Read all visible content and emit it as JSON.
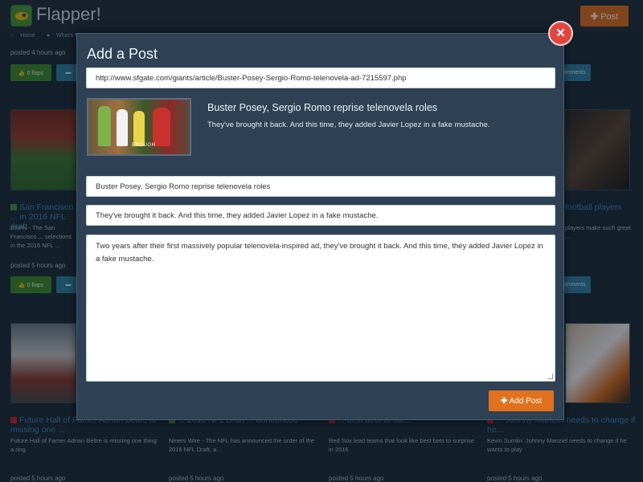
{
  "app": {
    "brand": "Flapper!"
  },
  "header": {
    "post_button_label": "Post",
    "post_button_icon": "plus-icon"
  },
  "breadcrumb": {
    "home": "Home",
    "whats_new": "What's New"
  },
  "background": {
    "top_posted": "posted 4 hours ago",
    "flap_label": "0 flaps",
    "comments_label": "comments",
    "row1": {
      "posted": "posted 5 hours ago",
      "cards": [
        {
          "title": "San Francisco ... in 2016 NFL draft",
          "desc": "ESPN - The San Francisco ... selections in the 2016 NFL ...",
          "source_color": "#4c9a37"
        },
        {
          "title": "football players",
          "desc": "players make such great ...",
          "source_color": "#4c9a37"
        }
      ]
    },
    "row2": {
      "posted": "posted 5 hours ago",
      "cards": [
        {
          "title": "Future Hall of Famer Adrian Beltre is missing one ...",
          "desc": "Future Hall of Famer Adrian Beltre is missing one thing: a ring",
          "source_color": "#d0212d"
        },
        {
          "title": "... 2016 NFL Draft ... announced",
          "desc": "Niners Wire - The NFL has announced the order of the 2016 NFL Draft, a...",
          "source_color": "#4c9a37"
        },
        {
          "title": "... best bets to sur...",
          "desc": "Red Sox lead teams that look like best bets to surprise in 2016",
          "source_color": "#d0212d"
        },
        {
          "title": "... Johnny Manziel needs to change if he...",
          "desc": "Kevin Sumlin: Johnny Manziel needs to change if he wants to play",
          "source_color": "#d0212d"
        }
      ]
    }
  },
  "modal": {
    "title": "Add a Post",
    "url_value": "http://www.sfgate.com/giants/article/Buster-Posey-Sergio-Romo-telenovela-ad-7215597.php",
    "preview": {
      "title": "Buster Posey, Sergio Romo reprise telenovela roles",
      "description": "They've brought it back. And this time, they added Javier Lopez in a fake mustache.",
      "image_caption": "ENOUGH"
    },
    "title_field_value": "Buster Posey, Sergio Romo reprise telenovela roles",
    "summary_field_value": "They've brought it back. And this time, they added Javier Lopez in a fake mustache.",
    "body_field_value": "Two years after their first massively popular telenovela-inspired ad, they've brought it back. And this time, they added Javier Lopez in a fake mustache.",
    "add_post_label": "Add Post",
    "add_post_icon": "plus-icon",
    "close_icon": "close-icon"
  },
  "colors": {
    "accent_orange": "#e2711d",
    "flap_green": "#3f8f2f",
    "comment_blue": "#2f84a6",
    "close_red": "#e0463d",
    "link_blue": "#3a8bc8"
  }
}
